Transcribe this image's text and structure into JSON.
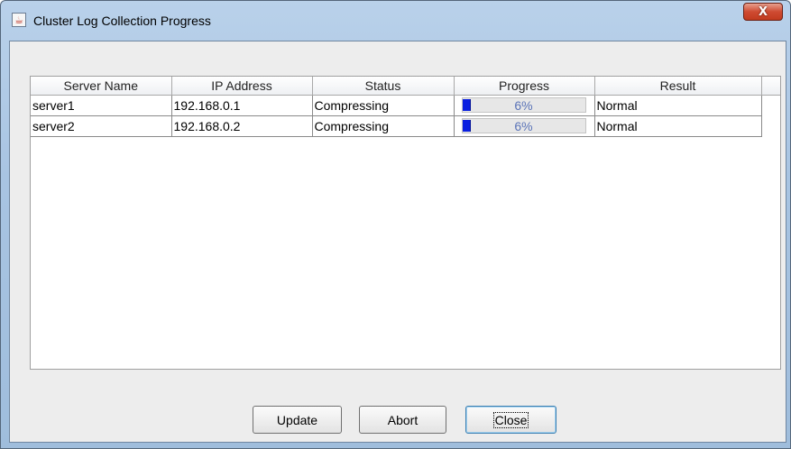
{
  "window": {
    "title": "Cluster Log Collection Progress",
    "app_icon": "java-cup-icon",
    "close_glyph": "X"
  },
  "table": {
    "columns": [
      "Server Name",
      "IP Address",
      "Status",
      "Progress",
      "Result"
    ],
    "rows": [
      {
        "server_name": "server1",
        "ip_address": "192.168.0.1",
        "status": "Compressing",
        "progress": 6,
        "progress_label": "6%",
        "result": "Normal"
      },
      {
        "server_name": "server2",
        "ip_address": "192.168.0.2",
        "status": "Compressing",
        "progress": 6,
        "progress_label": "6%",
        "result": "Normal"
      }
    ]
  },
  "buttons": {
    "update": "Update",
    "abort": "Abort",
    "close": "Close"
  },
  "colors": {
    "progress_fill": "#0a1fe0",
    "progress_text": "#5b74b8",
    "titlebar": "#b9d1ea",
    "close_button": "#cf4b32"
  }
}
